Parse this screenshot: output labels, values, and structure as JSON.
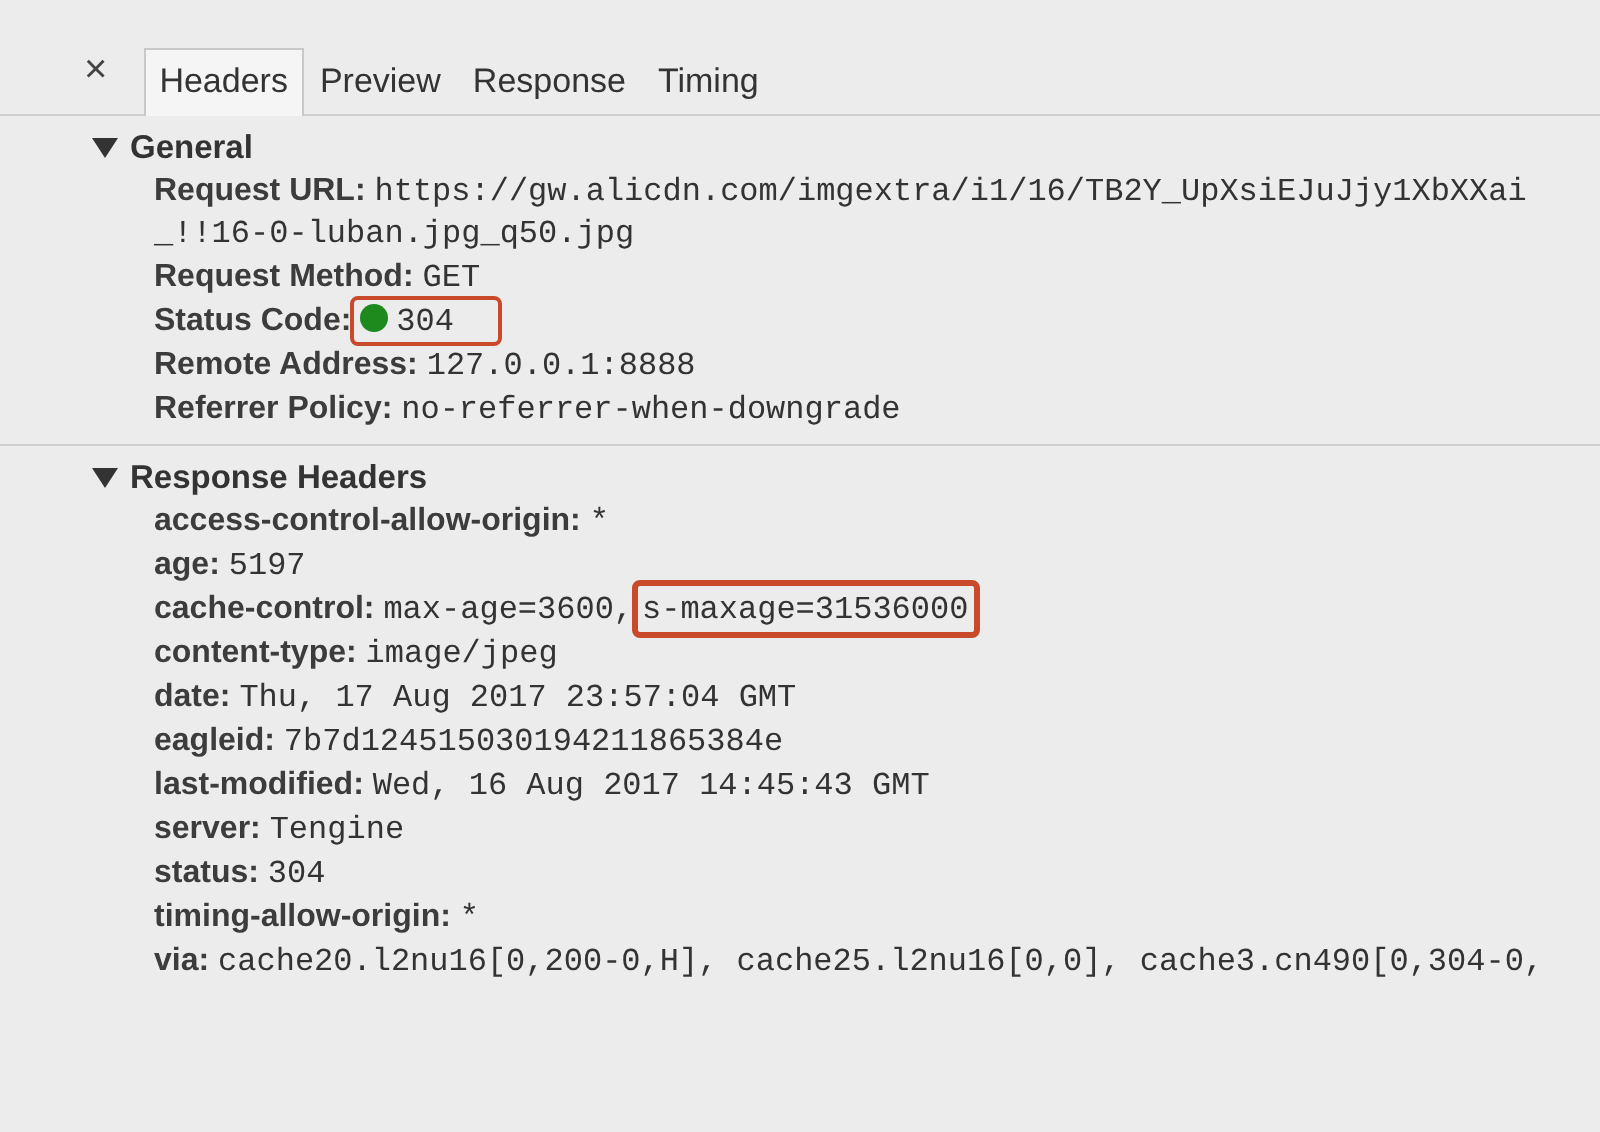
{
  "close_label": "×",
  "tabs": [
    {
      "label": "Headers",
      "selected": true
    },
    {
      "label": "Preview",
      "selected": false
    },
    {
      "label": "Response",
      "selected": false
    },
    {
      "label": "Timing",
      "selected": false
    }
  ],
  "sections": [
    {
      "title": "General",
      "expanded": true,
      "rows": [
        {
          "name": "Request URL:",
          "value": "https://gw.alicdn.com/imgextra/i1/16/TB2Y_UpXsiEJuJjy1XbXXai",
          "continued": "_!!16-0-luban.jpg_q50.jpg",
          "highlighted": false
        },
        {
          "name": "Request Method:",
          "value": "GET",
          "highlighted": false
        },
        {
          "name": "Status Code:",
          "value": "304",
          "color": "#1e8a1e",
          "highlighted": true
        },
        {
          "name": "Remote Address:",
          "value": "127.0.0.1:8888",
          "highlighted": false
        },
        {
          "name": "Referrer Policy:",
          "value": "no-referrer-when-downgrade",
          "highlighted": false
        }
      ]
    },
    {
      "title": "Response Headers",
      "expanded": true,
      "rows": [
        {
          "name": "access-control-allow-origin:",
          "value": "*",
          "highlighted": false
        },
        {
          "name": "age:",
          "value": "5197",
          "highlighted": false
        },
        {
          "name": "cache-control:",
          "value": "max-age=3600,",
          "extra": "s-maxage=31536000",
          "highlighted": true
        },
        {
          "name": "content-type:",
          "value": "image/jpeg",
          "highlighted": false
        },
        {
          "name": "date:",
          "value": "Thu, 17 Aug 2017 23:57:04 GMT",
          "highlighted": false
        },
        {
          "name": "eagleid:",
          "value": "7b7d124515030194211865384e",
          "highlighted": false
        },
        {
          "name": "last-modified:",
          "value": "Wed, 16 Aug 2017 14:45:43 GMT",
          "highlighted": false
        },
        {
          "name": "server:",
          "value": "Tengine",
          "highlighted": false
        },
        {
          "name": "status:",
          "value": "304",
          "highlighted": false
        },
        {
          "name": "timing-allow-origin:",
          "value": "*",
          "highlighted": false
        },
        {
          "name": "via:",
          "value": "cache20.l2nu16[0,200-0,H], cache25.l2nu16[0,0], cache3.cn490[0,304-0,",
          "highlighted": false
        }
      ]
    }
  ]
}
